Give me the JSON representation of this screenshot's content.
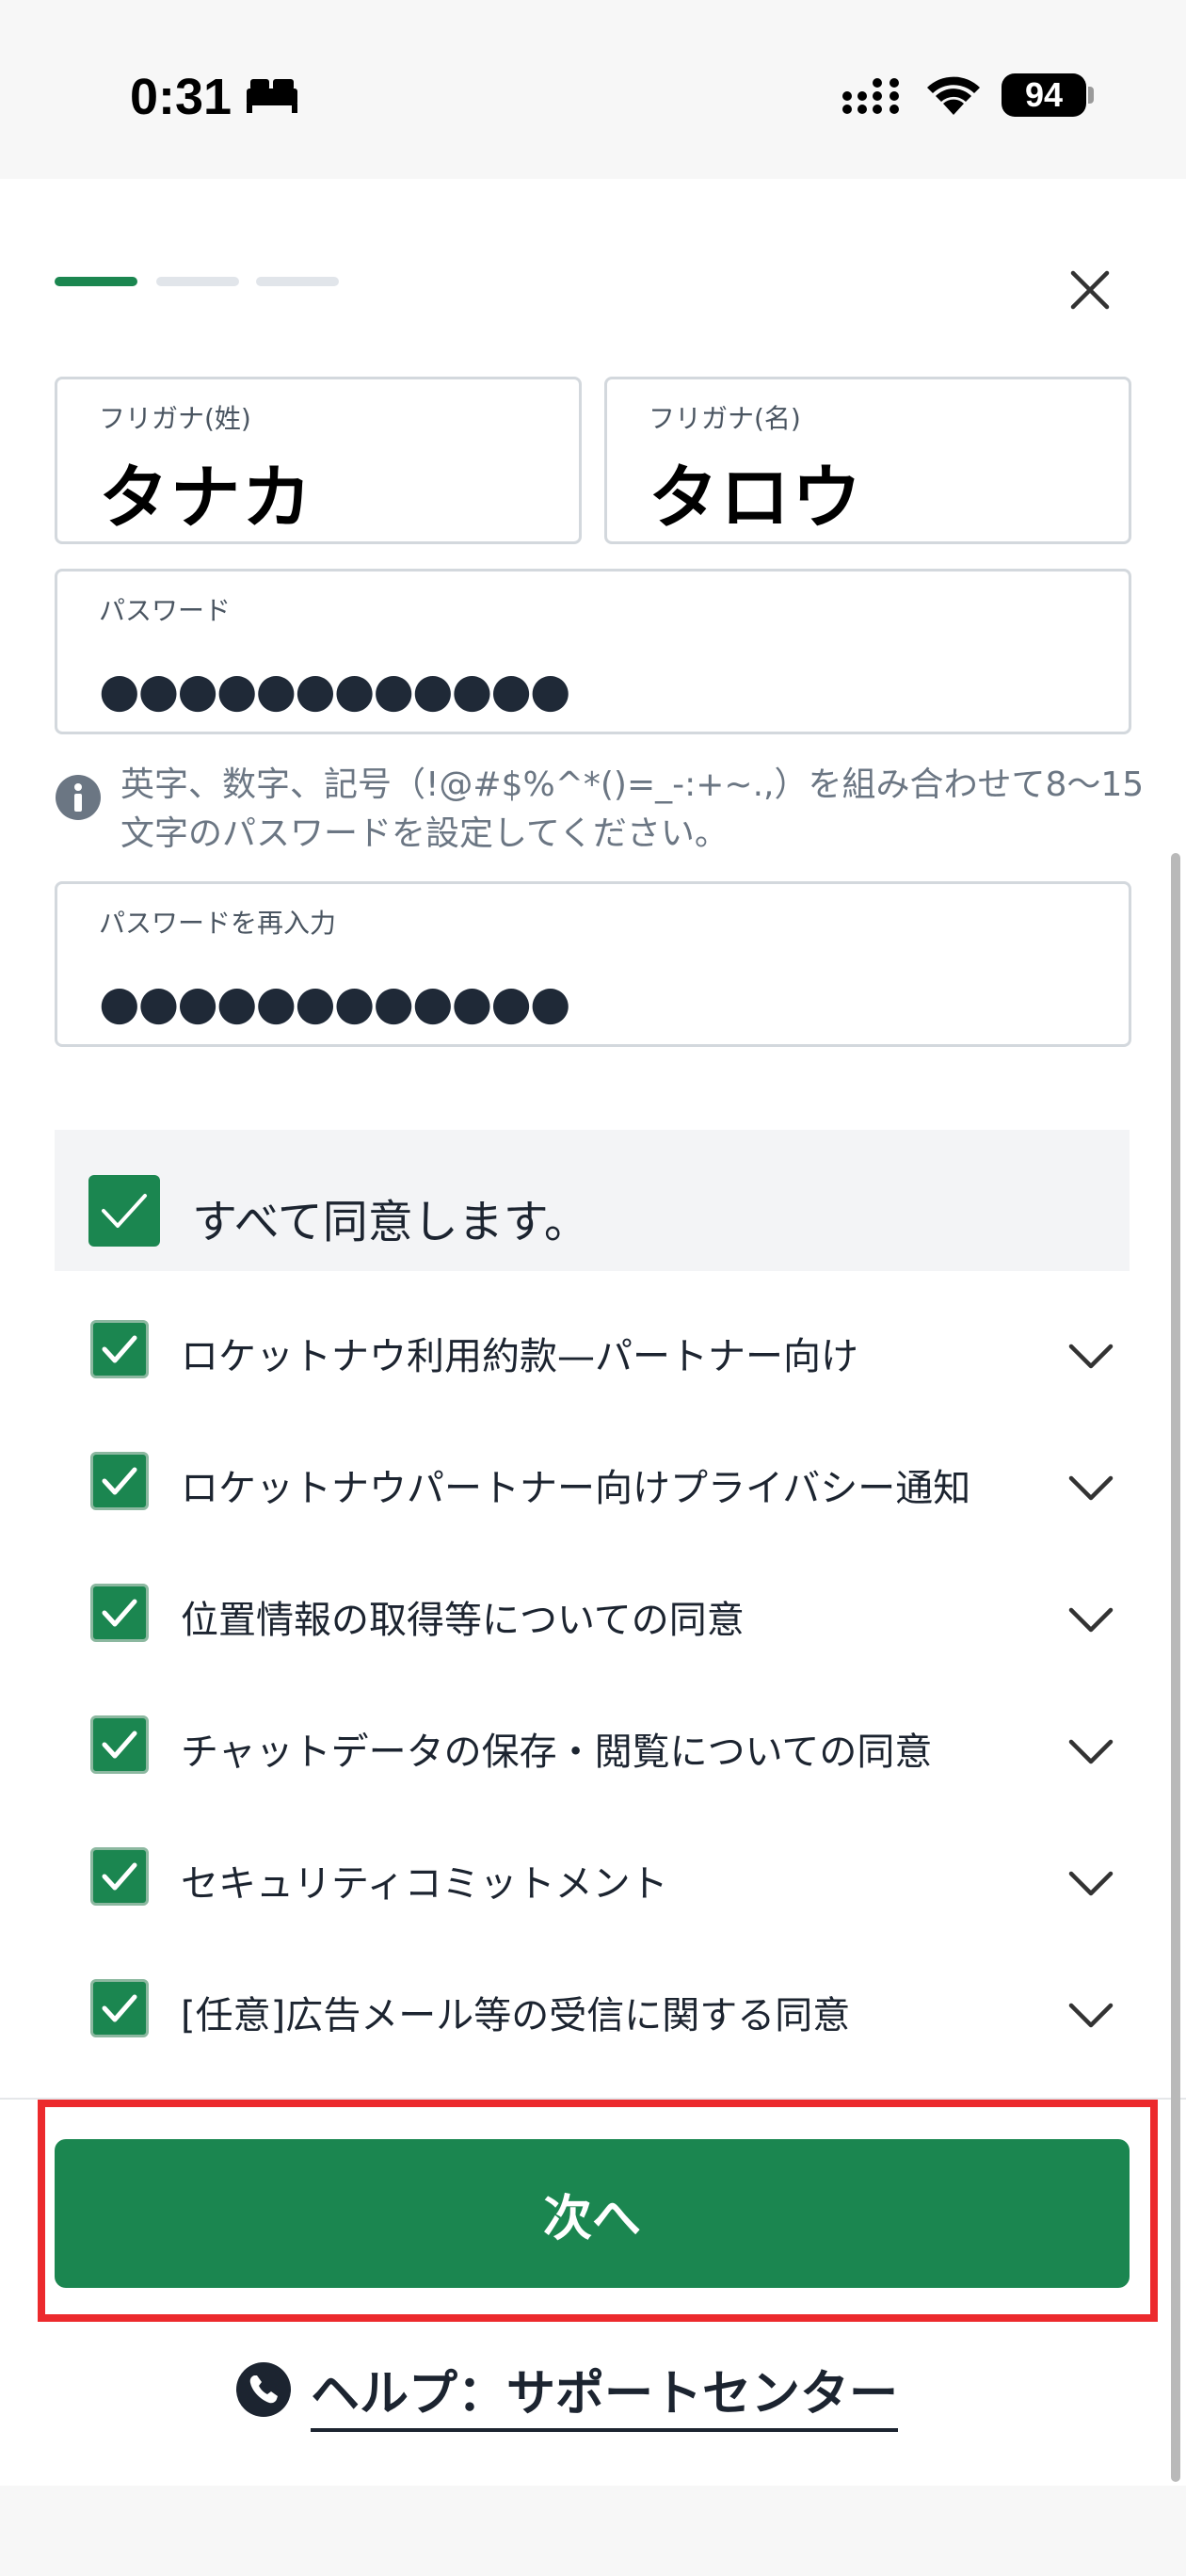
{
  "status_bar": {
    "time": "0:31",
    "battery": "94"
  },
  "progress": {
    "current_step": 1,
    "total_steps": 3
  },
  "form": {
    "furigana_last": {
      "label": "フリガナ(姓)",
      "value": "タナカ"
    },
    "furigana_first": {
      "label": "フリガナ(名)",
      "value": "タロウ"
    },
    "password": {
      "label": "パスワード",
      "masked_value": "●●●●●●●●●●●●"
    },
    "password_hint": "英字、数字、記号（!@#$%^*()=_-:+~.,）を組み合わせて8〜15文字のパスワードを設定してください。",
    "password_confirm": {
      "label": "パスワードを再入力",
      "masked_value": "●●●●●●●●●●●●"
    }
  },
  "agreements": {
    "all_label": "すべて同意します。",
    "items": [
      {
        "label": "ロケットナウ利用約款—パートナー向け",
        "checked": true
      },
      {
        "label": "ロケットナウパートナー向けプライバシー通知",
        "checked": true
      },
      {
        "label": "位置情報の取得等についての同意",
        "checked": true
      },
      {
        "label": "チャットデータの保存・閲覧についての同意",
        "checked": true
      },
      {
        "label": "セキュリティコミットメント",
        "checked": true
      },
      {
        "label": "[任意]広告メール等の受信に関する同意",
        "checked": true
      }
    ]
  },
  "next_button": "次へ",
  "help_link": "ヘルプ：サポートセンター",
  "colors": {
    "accent": "#1b8650",
    "highlight": "#ec2a2d"
  }
}
